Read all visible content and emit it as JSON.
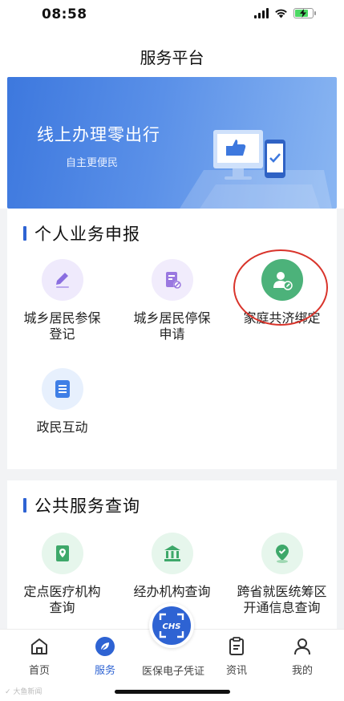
{
  "status_bar": {
    "time": "08:58",
    "battery_level": 0.8,
    "battery_charging": true
  },
  "header": {
    "title": "服务平台"
  },
  "banner": {
    "title": "线上办理零出行",
    "subtitle": "自主更便民"
  },
  "personal_section": {
    "title": "个人业务申报",
    "items": [
      {
        "label": "城乡居民参保登记",
        "icon": "edit-pencil-icon",
        "color": "#8a6ee0",
        "bg": "#efeafc"
      },
      {
        "label": "城乡居民停保申请",
        "icon": "document-stop-icon",
        "color": "#9a78e0",
        "bg": "#f1ecfc"
      },
      {
        "label": "家庭共济绑定",
        "icon": "user-edit-icon",
        "color": "#ffffff",
        "bg": "#4cb27a"
      },
      {
        "label": "政民互动",
        "icon": "list-document-icon",
        "color": "#3f7fe6",
        "bg": "#e7f0fd"
      }
    ]
  },
  "public_section": {
    "title": "公共服务查询",
    "items": [
      {
        "label": "定点医疗机构查询",
        "icon": "location-pin-icon",
        "color": "#3ea86a",
        "bg": "#e6f6ec"
      },
      {
        "label": "经办机构查询",
        "icon": "institution-building-icon",
        "color": "#3ea86a",
        "bg": "#e6f6ec"
      },
      {
        "label": "跨省就医统筹区开通信息查询",
        "icon": "location-check-icon",
        "color": "#3ea86a",
        "bg": "#e6f6ec"
      }
    ]
  },
  "tabbar": {
    "tabs": [
      {
        "label": "首页",
        "icon": "home-icon"
      },
      {
        "label": "服务",
        "icon": "service-leaf-icon",
        "active": true
      },
      {
        "label": "医保电子凭证",
        "icon": "chs-scan-icon",
        "badge_text": "CHS"
      },
      {
        "label": "资讯",
        "icon": "news-clipboard-icon"
      },
      {
        "label": "我的",
        "icon": "profile-icon"
      }
    ]
  },
  "colors": {
    "accent": "#2e63d3",
    "highlight_circle": "#d9342b"
  }
}
